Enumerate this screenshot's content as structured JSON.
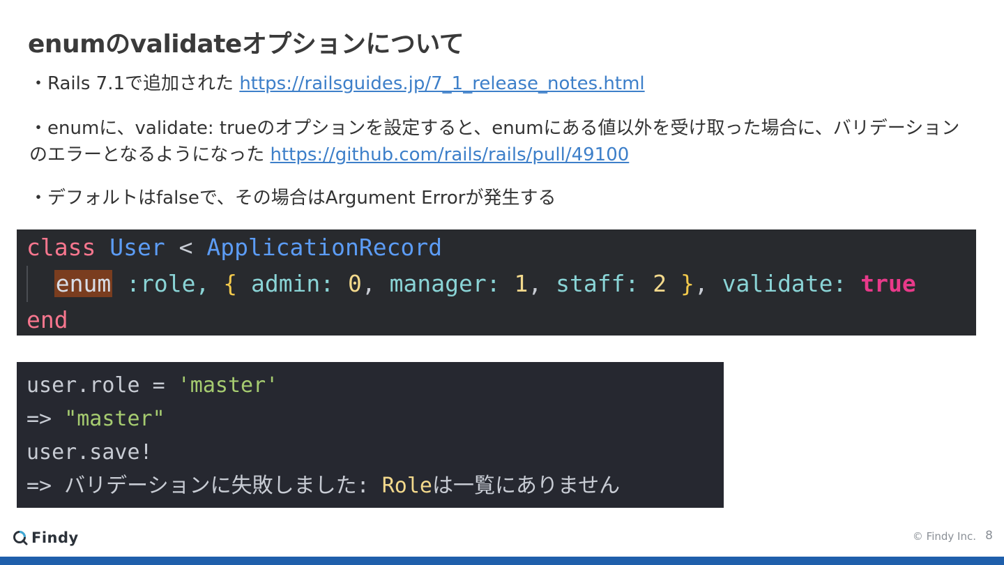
{
  "slide": {
    "title": "enumのvalidateオプションについて",
    "bullets": [
      {
        "text": "・Rails 7.1で追加された ",
        "link": "https://railsguides.jp/7_1_release_notes.html"
      },
      {
        "text": "・enumに、validate: trueのオプションを設定すると、enumにある値以外を受け取った場合に、バリデーションのエラーとなるようになった ",
        "link": "https://github.com/rails/rails/pull/49100"
      },
      {
        "text": "・デフォルトはfalseで、その場合はArgument Errorが発生する"
      }
    ]
  },
  "code_class": {
    "line1": {
      "kw": "class",
      "name": "User",
      "op": "<",
      "parent": "ApplicationRecord"
    },
    "line2": {
      "enum": "enum",
      "sym": ":role,",
      "brace_open": "{",
      "k1": "admin:",
      "v1": "0",
      "k2": "manager:",
      "v2": "1",
      "k3": "staff:",
      "v3": "2",
      "brace_close": "}",
      "comma": ",",
      "k4": "validate:",
      "v4": "true"
    },
    "line3": {
      "kw": "end"
    }
  },
  "code_console": {
    "line1": {
      "lhs": "user.role = ",
      "str": "'master'"
    },
    "line2": {
      "arrow": "=> ",
      "str": "\"master\""
    },
    "line3": {
      "text": "user.save!"
    },
    "line4": {
      "prefix": "=> バリデーションに失敗しました: ",
      "role": "Role",
      "suffix": "は一覧にありません"
    }
  },
  "footer": {
    "brand": "Findy",
    "copyright": "© Findy Inc.",
    "page": "8"
  },
  "colors": {
    "accent_bar": "#1f5fab",
    "link": "#3d7fc9",
    "code_bg": "#282a2e"
  }
}
